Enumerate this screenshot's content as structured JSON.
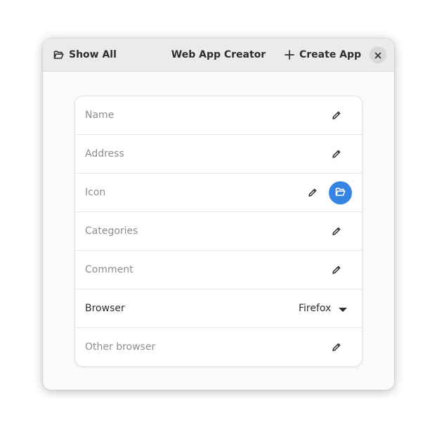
{
  "header": {
    "show_all_label": "Show All",
    "title": "Web App Creator",
    "create_app_label": "Create App"
  },
  "fields": {
    "name": {
      "placeholder": "Name"
    },
    "address": {
      "placeholder": "Address"
    },
    "icon": {
      "placeholder": "Icon"
    },
    "categories": {
      "placeholder": "Categories"
    },
    "comment": {
      "placeholder": "Comment"
    },
    "browser": {
      "label": "Browser",
      "selected": "Firefox"
    },
    "other_browser": {
      "placeholder": "Other browser"
    }
  },
  "icons": {
    "show_all": "folder-open-icon",
    "create_app": "plus-icon",
    "close": "close-icon",
    "edit": "pencil-icon",
    "icon_picker": "folder-open-icon",
    "dropdown": "caret-down-icon"
  },
  "colors": {
    "accent": "#3584e4",
    "header_bg": "#ebebeb",
    "window_bg": "#fafafa"
  }
}
